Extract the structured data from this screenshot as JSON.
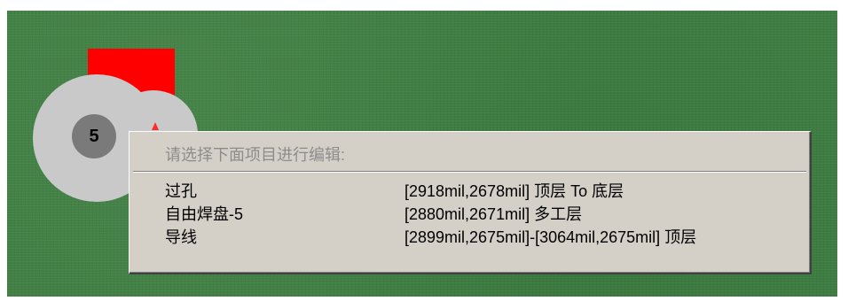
{
  "canvas": {
    "board_color": "#3f7e43",
    "copper_color": "#ff0000",
    "pad_color": "#c9c9c9",
    "pad_label": "5"
  },
  "popup": {
    "title": "请选择下面项目进行编辑:",
    "items": [
      {
        "name": "过孔",
        "detail": "[2918mil,2678mil] 顶层 To 底层"
      },
      {
        "name": "自由焊盘-5",
        "detail": "[2880mil,2671mil] 多工层"
      },
      {
        "name": "导线",
        "detail": "[2899mil,2675mil]-[3064mil,2675mil] 顶层"
      }
    ]
  }
}
